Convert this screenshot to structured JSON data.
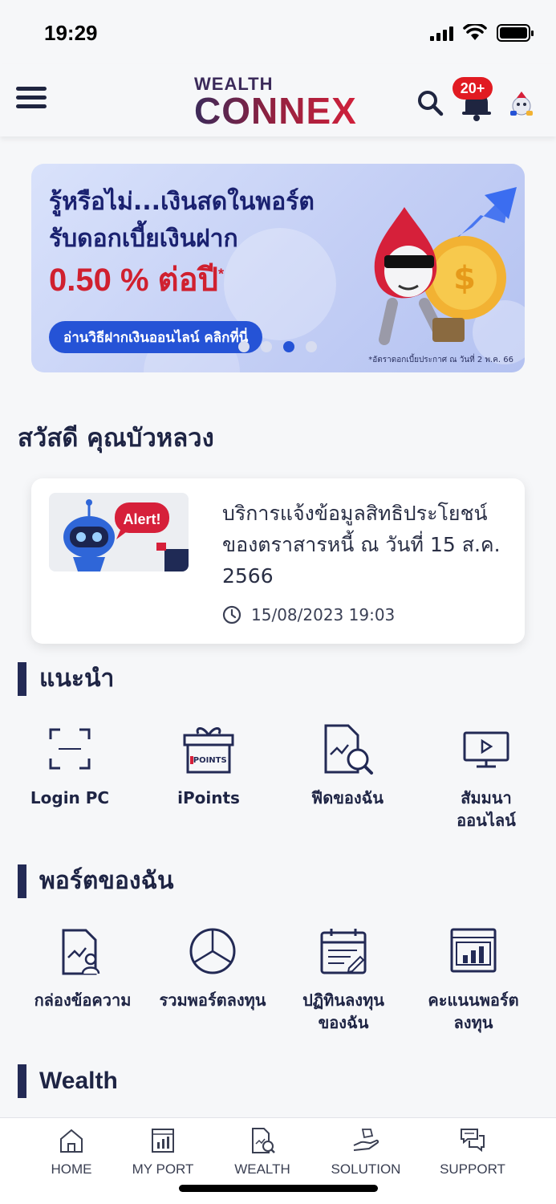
{
  "status_bar": {
    "time": "19:29"
  },
  "header": {
    "logo_top": "WEALTH",
    "logo_bottom": "CONNEX",
    "notification_badge": "20+"
  },
  "banner": {
    "line1": "รู้หรือไม่...เงินสดในพอร์ต",
    "line2": "รับดอกเบี้ยเงินฝาก",
    "rate": "0.50 % ต่อปี",
    "rate_mark": "*",
    "cta": "อ่านวิธีฝากเงินออนไลน์ คลิกที่นี่",
    "note": "*อัตราดอกเบี้ยประกาศ ณ วันที่ 2 พ.ค. 66",
    "slides": 4,
    "active_slide": 3
  },
  "greeting": "สวัสดี คุณบัวหลวง",
  "news": {
    "thumb_text": "Alert!",
    "title": "บริการแจ้งข้อมูลสิทธิประโยชน์ของตราสารหนี้ ณ วันที่ 15 ส.ค. 2566",
    "timestamp": "15/08/2023 19:03"
  },
  "recommend": {
    "title": "แนะนำ",
    "items": [
      {
        "label": "Login PC",
        "icon": "scan-icon"
      },
      {
        "label": "iPoints",
        "icon": "gift-icon"
      },
      {
        "label": "ฟีดของฉัน",
        "icon": "feed-icon"
      },
      {
        "label": "สัมมนา\nออนไลน์",
        "icon": "seminar-icon"
      }
    ]
  },
  "myport": {
    "title": "พอร์ตของฉัน",
    "items": [
      {
        "label": "กล่องข้อความ",
        "icon": "inbox-icon"
      },
      {
        "label": "รวมพอร์ตลงทุน",
        "icon": "pie-chart-icon"
      },
      {
        "label": "ปฏิทินลงทุน\nของฉัน",
        "icon": "calendar-icon"
      },
      {
        "label": "คะแนนพอร์ต\nลงทุน",
        "icon": "score-icon"
      }
    ]
  },
  "wealth_section": {
    "title": "Wealth"
  },
  "bottom_nav": {
    "items": [
      {
        "label": "HOME",
        "icon": "home-icon"
      },
      {
        "label": "MY PORT",
        "icon": "my-port-icon"
      },
      {
        "label": "WEALTH",
        "icon": "wealth-icon"
      },
      {
        "label": "SOLUTION",
        "icon": "solution-icon"
      },
      {
        "label": "SUPPORT",
        "icon": "support-icon"
      }
    ]
  },
  "colors": {
    "primary": "#232a55",
    "accent_red": "#e11b22",
    "banner_blue": "#2553d6"
  }
}
